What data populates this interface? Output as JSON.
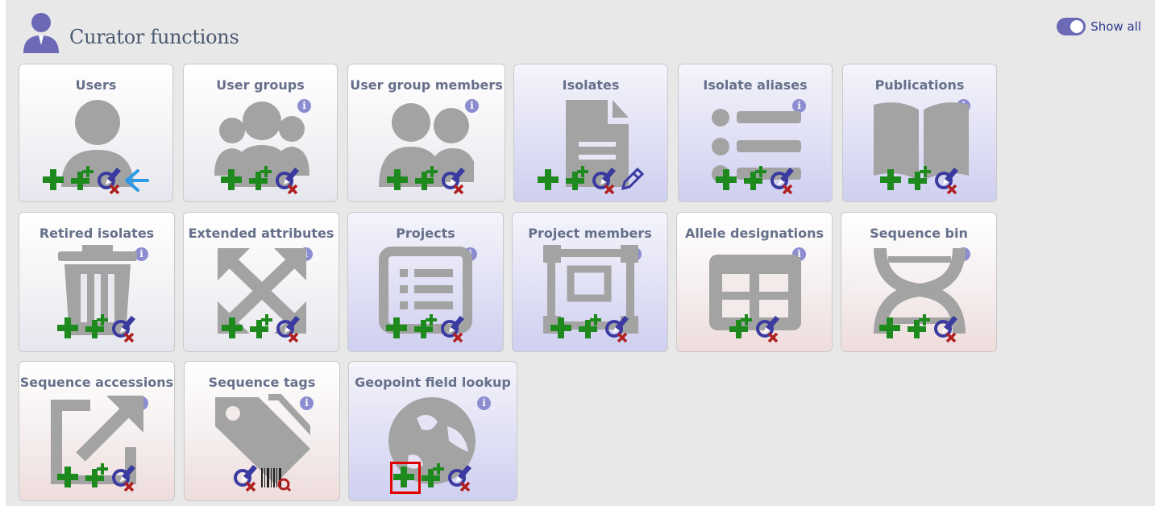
{
  "header": {
    "title": "Curator functions",
    "toggle_label": "Show all"
  },
  "tiles": [
    {
      "label": "Users"
    },
    {
      "label": "User groups"
    },
    {
      "label": "User group members"
    },
    {
      "label": "Isolates"
    },
    {
      "label": "Isolate aliases"
    },
    {
      "label": "Publications"
    },
    {
      "label": "Retired isolates"
    },
    {
      "label": "Extended attributes"
    },
    {
      "label": "Projects"
    },
    {
      "label": "Project members"
    },
    {
      "label": "Allele designations"
    },
    {
      "label": "Sequence bin"
    },
    {
      "label": "Sequence accessions"
    },
    {
      "label": "Sequence tags"
    },
    {
      "label": "Geopoint field lookup"
    }
  ],
  "info_glyph": "i",
  "colors": {
    "add": "#1e8a1e",
    "query": "#3a3aa0",
    "delete": "#b02020",
    "arrow": "#2c9ae8",
    "highlight": "#e00000"
  }
}
